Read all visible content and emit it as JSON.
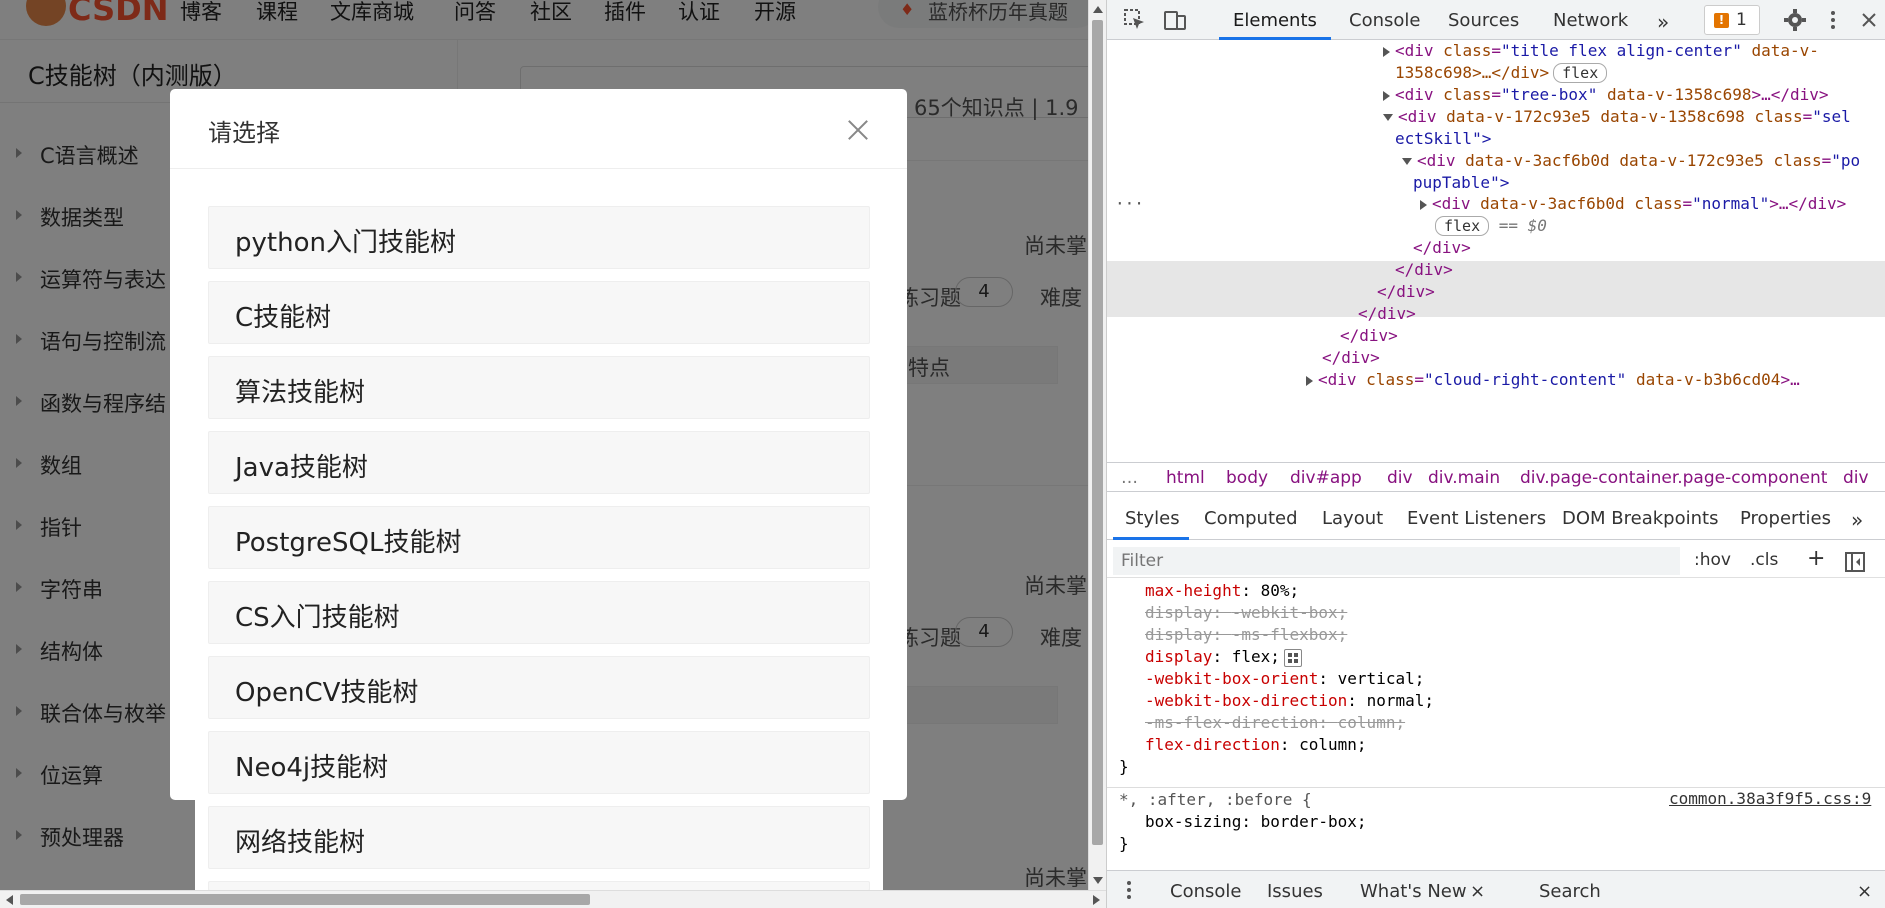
{
  "site": {
    "logo_text": "CSDN",
    "nav": [
      "博客",
      "课程",
      "文库商城",
      "问答",
      "社区",
      "插件",
      "认证",
      "开源"
    ],
    "search_hot": "蓝桥杯历年真题"
  },
  "sidebar": {
    "title": "C技能树（内测版）",
    "items": [
      "C语言概述",
      "数据类型",
      "运算符与表达",
      "语句与控制流",
      "函数与程序结",
      "数组",
      "指针",
      "字符串",
      "结构体",
      "联合体与枚举",
      "位运算",
      "预处理器"
    ]
  },
  "content": {
    "stats": "65个知识点  |  1.9",
    "not_mastered": "尚未掌",
    "exercises": "练习题",
    "difficulty": "难度",
    "count": "4",
    "feature": "特点"
  },
  "modal": {
    "title": "请选择",
    "options": [
      "python入门技能树",
      "C技能树",
      "算法技能树",
      "Java技能树",
      "PostgreSQL技能树",
      "CS入门技能树",
      "OpenCV技能树",
      "Neo4j技能树",
      "网络技能树"
    ]
  },
  "devtools": {
    "tabs": [
      "Elements",
      "Console",
      "Sources",
      "Network"
    ],
    "issues_count": "1",
    "dom": {
      "l1_class": "title flex align-center",
      "l1_attr": "data-v-",
      "l1_cont": "1358c698>…</div>",
      "flex": "flex",
      "l2_class": "tree-box",
      "l2_attr": "data-v-1358c698",
      "l3_a": "data-v-172c93e5",
      "l3_b": "data-v-1358c698",
      "l3_class": "sel",
      "l3_cont": "ectSkill\">",
      "l4_a": "data-v-3acf6b0d",
      "l4_b": "data-v-172c93e5",
      "l4_class": "po",
      "l4_cont": "pupTable\">",
      "l5_a": "data-v-3acf6b0d",
      "l5_class": "normal",
      "eq": "== $0",
      "close": "</div>",
      "l6_class": "cloud-right-content",
      "l6_attr": "data-v-b3b6cd04"
    },
    "breadcrumbs": [
      "html",
      "body",
      "div#app",
      "div",
      "div.main",
      "div.page-container.page-component",
      "div"
    ],
    "styles_tabs": [
      "Styles",
      "Computed",
      "Layout",
      "Event Listeners",
      "DOM Breakpoints",
      "Properties"
    ],
    "filter_placeholder": "Filter",
    "hov": ":hov",
    "cls": ".cls",
    "css": [
      {
        "prop": "max-height",
        "value": "80%;",
        "struck": false
      },
      {
        "prop": "display",
        "value": "-webkit-box;",
        "struck": true
      },
      {
        "prop": "display",
        "value": "-ms-flexbox;",
        "struck": true
      },
      {
        "prop": "display",
        "value": "flex;",
        "struck": false
      },
      {
        "prop": "-webkit-box-orient",
        "value": "vertical;",
        "struck": false
      },
      {
        "prop": "-webkit-box-direction",
        "value": "normal;",
        "struck": false
      },
      {
        "prop": "-ms-flex-direction",
        "value": "column;",
        "struck": true
      },
      {
        "prop": "flex-direction",
        "value": "column;",
        "struck": false
      }
    ],
    "universal_selector": "*, :after, :before {",
    "universal_prop": "box-sizing",
    "universal_value": "border-box;",
    "source_link": "common.38a3f9f5.css:9",
    "drawer_tabs": [
      "Console",
      "Issues",
      "What's New",
      "Search"
    ]
  }
}
